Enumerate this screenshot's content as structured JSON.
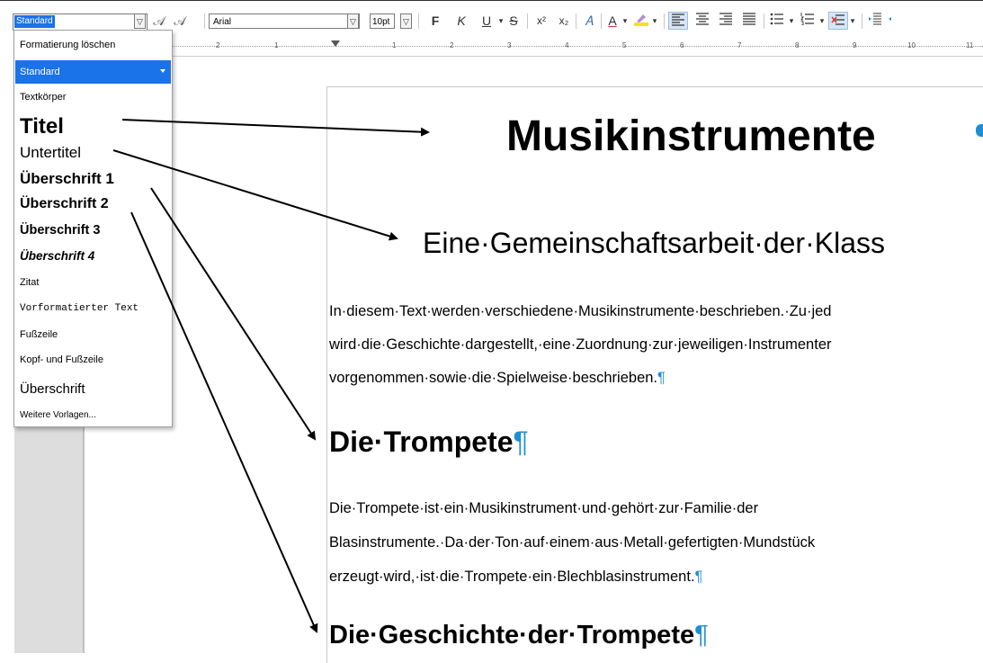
{
  "toolbar": {
    "style_value": "Standard",
    "font_value": "Arial",
    "size_value": "10pt",
    "bold": "F",
    "italic": "K",
    "underline": "U",
    "strike": "S",
    "superscript": "x²",
    "subscript": "x₂"
  },
  "ruler": {
    "numbers": [
      "2",
      "1",
      "1",
      "2",
      "3",
      "4",
      "5",
      "6",
      "7",
      "8",
      "9",
      "10",
      "11"
    ]
  },
  "dropdown": {
    "items": {
      "clear": "Formatierung löschen",
      "standard": "Standard",
      "textkoerper": "Textkörper",
      "titel": "Titel",
      "untertitel": "Untertitel",
      "h1": "Überschrift 1",
      "h2": "Überschrift 2",
      "h3": "Überschrift 3",
      "h4": "Überschrift 4",
      "zitat": "Zitat",
      "vorformatiert": "Vorformatierter Text",
      "fusszeile": "Fußzeile",
      "kopf_fuss": "Kopf- und Fußzeile",
      "ueberschrift": "Überschrift",
      "weitere": "Weitere Vorlagen..."
    }
  },
  "document": {
    "title": "Musikinstrumente",
    "subtitle": "Eine·Gemeinschaftsarbeit·der·Klass",
    "para1_line1": "In·diesem·Text·werden·verschiedene·Musikinstrumente·beschrieben.·Zu·jed",
    "para1_line2": "wird·die·Geschichte·dargestellt,·eine·Zuordnung·zur·jeweiligen·Instrumenter",
    "para1_line3": "vorgenommen·sowie·die·Spielweise·beschrieben.",
    "heading1": "Die·Trompete",
    "para2_line1": "Die·Trompete·ist·ein·Musikinstrument·und·gehört·zur·Familie·der",
    "para2_line2": "Blasinstrumente.·Da·der·Ton·auf·einem·aus·Metall·gefertigten·Mundstück",
    "para2_line3": "erzeugt·wird,·ist·die·Trompete·ein·Blechblasinstrument.",
    "heading2": "Die·Geschichte·der·Trompete",
    "pilcrow": "¶"
  }
}
